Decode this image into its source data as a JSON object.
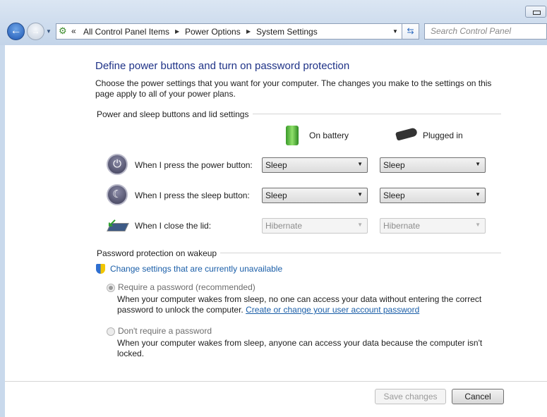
{
  "nav": {
    "breadcrumb": [
      "All Control Panel Items",
      "Power Options",
      "System Settings"
    ],
    "search_placeholder": "Search Control Panel",
    "overflow": "«"
  },
  "page": {
    "title": "Define power buttons and turn on password protection",
    "intro": "Choose the power settings that you want for your computer. The changes you make to the settings on this page apply to all of your power plans."
  },
  "buttons_section": {
    "header": "Power and sleep buttons and lid settings",
    "col_battery": "On battery",
    "col_plugged": "Plugged in",
    "rows": [
      {
        "label": "When I press the power button:",
        "battery": "Sleep",
        "plugged": "Sleep",
        "enabled": true
      },
      {
        "label": "When I press the sleep button:",
        "battery": "Sleep",
        "plugged": "Sleep",
        "enabled": true
      },
      {
        "label": "When I close the lid:",
        "battery": "Hibernate",
        "plugged": "Hibernate",
        "enabled": false
      }
    ]
  },
  "password_section": {
    "header": "Password protection on wakeup",
    "change_link": "Change settings that are currently unavailable",
    "require_label": "Require a password (recommended)",
    "require_desc": "When your computer wakes from sleep, no one can access your data without entering the correct password to unlock the computer.",
    "require_link": "Create or change your user account password",
    "norequire_label": "Don't require a password",
    "norequire_desc": "When your computer wakes from sleep, anyone can access your data because the computer isn't locked.",
    "selected": "require"
  },
  "footer": {
    "save": "Save changes",
    "cancel": "Cancel"
  }
}
